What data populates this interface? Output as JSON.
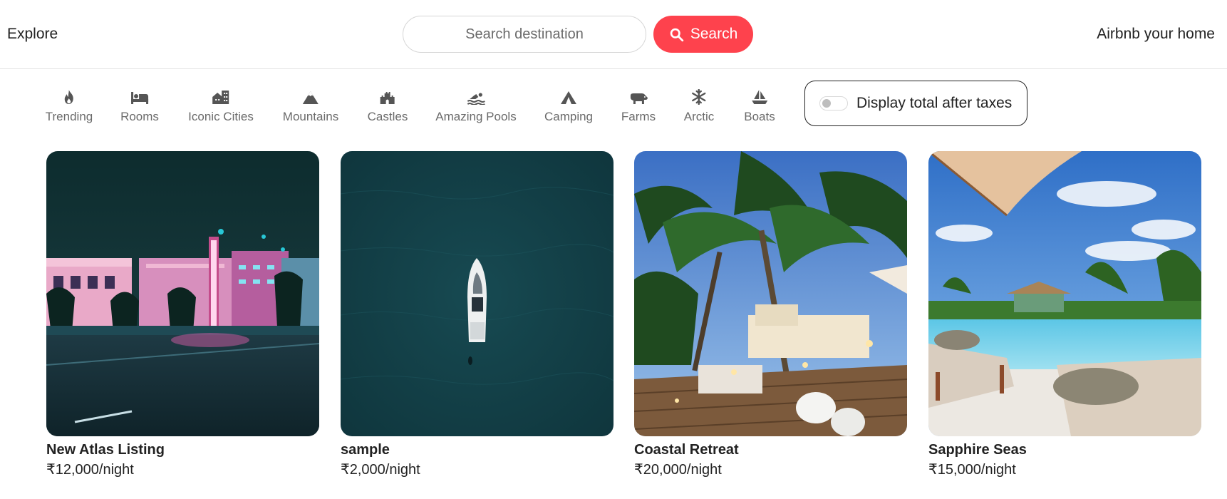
{
  "header": {
    "explore_label": "Explore",
    "search_placeholder": "Search destination",
    "search_button_label": "Search",
    "host_link_label": "Airbnb your home",
    "accent_color": "#fe424d"
  },
  "filters": [
    {
      "label": "Trending",
      "icon": "fire-icon"
    },
    {
      "label": "Rooms",
      "icon": "bed-icon"
    },
    {
      "label": "Iconic Cities",
      "icon": "city-icon"
    },
    {
      "label": "Mountains",
      "icon": "mountain-icon"
    },
    {
      "label": "Castles",
      "icon": "castle-icon"
    },
    {
      "label": "Amazing Pools",
      "icon": "swimmer-icon"
    },
    {
      "label": "Camping",
      "icon": "tent-icon"
    },
    {
      "label": "Farms",
      "icon": "cow-icon"
    },
    {
      "label": "Arctic",
      "icon": "snowflake-icon"
    },
    {
      "label": "Boats",
      "icon": "sailboat-icon"
    }
  ],
  "tax_toggle": {
    "label": "Display total after taxes",
    "enabled": false
  },
  "listings": [
    {
      "title": "New Atlas Listing",
      "price": "₹12,000/night",
      "image": "neon-hotel-night-photo"
    },
    {
      "title": "sample",
      "price": "₹2,000/night",
      "image": "yacht-aerial-ocean-photo"
    },
    {
      "title": "Coastal Retreat",
      "price": "₹20,000/night",
      "image": "palm-lounge-deck-photo"
    },
    {
      "title": "Sapphire Seas",
      "price": "₹15,000/night",
      "image": "resort-pool-photo"
    }
  ]
}
